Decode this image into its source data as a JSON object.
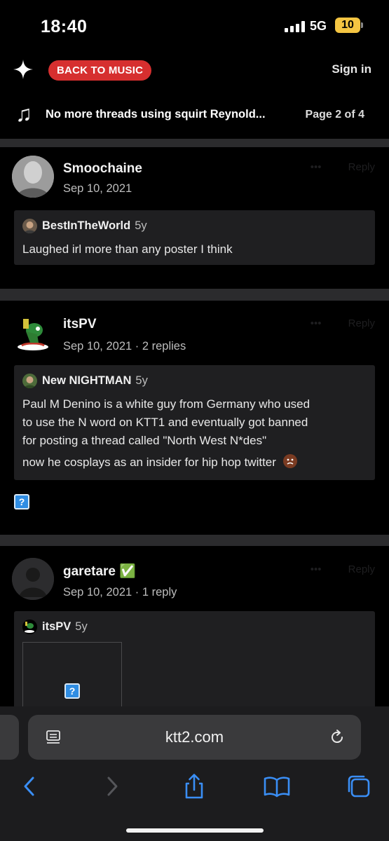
{
  "status_bar": {
    "time": "18:40",
    "network": "5G",
    "battery": "10"
  },
  "header": {
    "back_label": "BACK TO MUSIC",
    "sign_in_label": "Sign in"
  },
  "thread": {
    "title": "No more threads using squirt Reynold...",
    "page_info": "Page 2 of 4"
  },
  "posts": [
    {
      "username": "Smoochaine",
      "meta": "Sep 10, 2021",
      "quote": {
        "author": "BestInTheWorld",
        "time": "5y",
        "lines": [
          "Laughed irl more than any poster I think"
        ]
      }
    },
    {
      "username": "itsPV",
      "meta": "Sep 10, 2021 · 2 replies",
      "quote": {
        "author": "New NIGHTMAN",
        "time": "5y",
        "lines": [
          "Paul M Denino is a white guy from Germany who used",
          "to use the N word on KTT1 and eventually got banned",
          "for posting a thread called \"North West N*des\"",
          "now he cosplays as an insider for hip hop twitter"
        ]
      },
      "attachment": "?"
    },
    {
      "username": "garetare ✅",
      "meta": "Sep 10, 2021 · 1 reply",
      "quote": {
        "author": "itsPV",
        "time": "5y",
        "attachment": "?"
      }
    }
  ],
  "post_actions": {
    "more": "•••",
    "reply": "Reply"
  },
  "browser": {
    "url": "ktt2.com"
  }
}
